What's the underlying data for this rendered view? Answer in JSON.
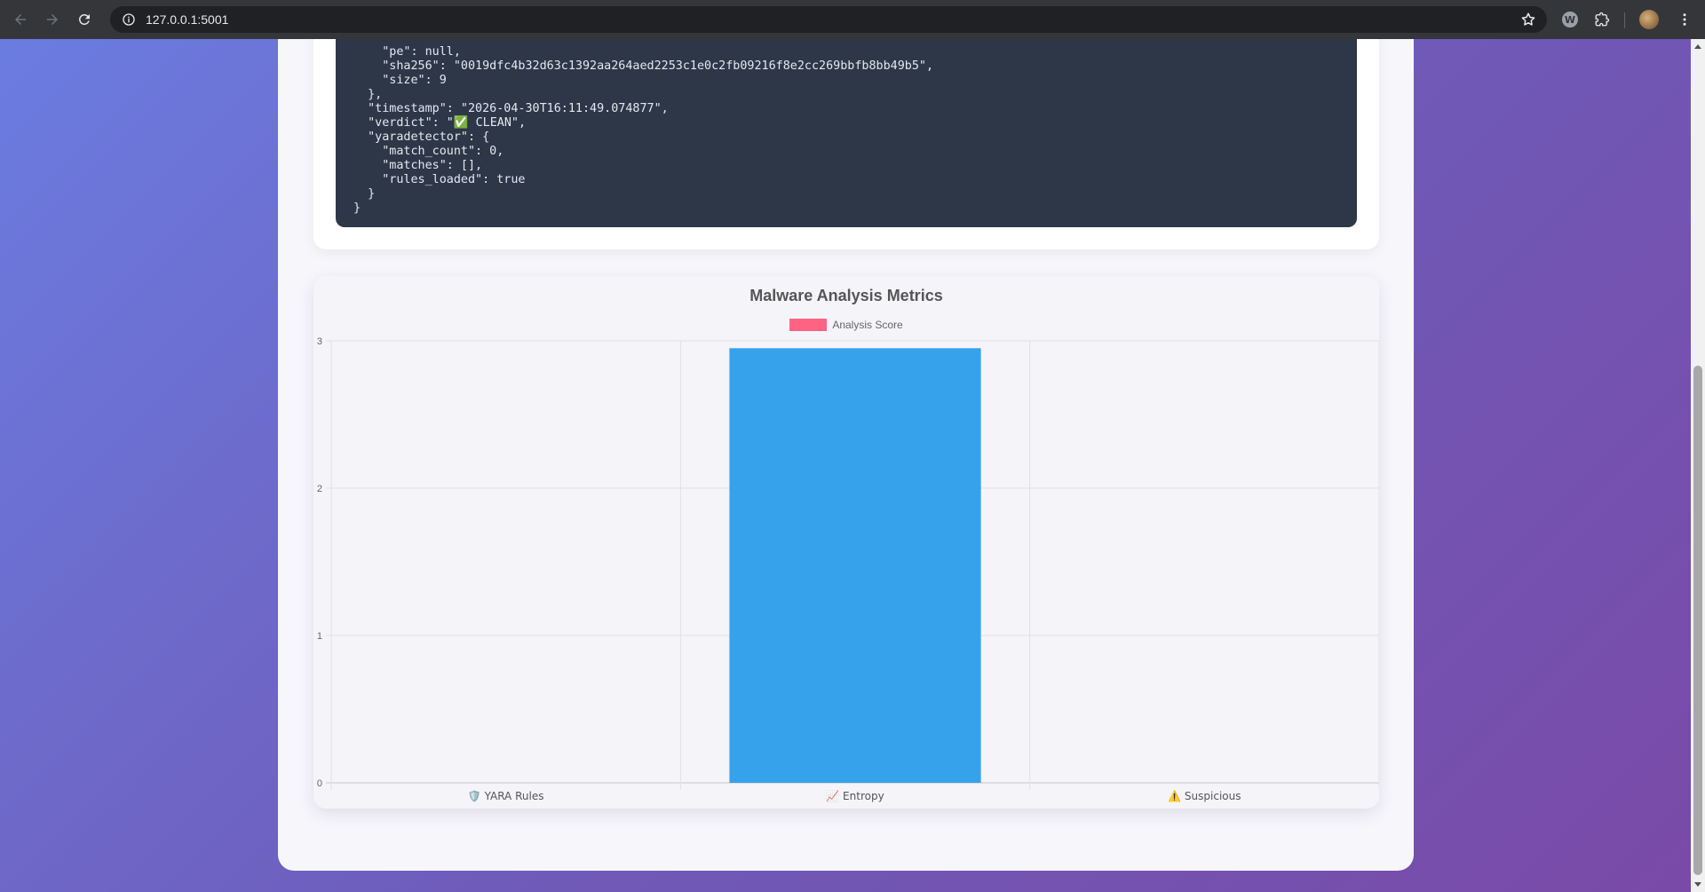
{
  "browser": {
    "url": "127.0.0.1:5001",
    "extension_letter": "W"
  },
  "json_output": {
    "lines": [
      "    \"pe\": null,",
      "    \"sha256\": \"0019dfc4b32d63c1392aa264aed2253c1e0c2fb09216f8e2cc269bbfb8bb49b5\",",
      "    \"size\": 9",
      "  },",
      "  \"timestamp\": \"2026-04-30T16:11:49.074877\",",
      "  \"verdict\": \"✅ CLEAN\",",
      "  \"yaradetector\": {",
      "    \"match_count\": 0,",
      "    \"matches\": [],",
      "    \"rules_loaded\": true",
      "  }",
      "}"
    ]
  },
  "chart_data": {
    "type": "bar",
    "title": "Malware Analysis Metrics",
    "categories": [
      "🛡️ YARA Rules",
      "📈 Entropy",
      "⚠️ Suspicious"
    ],
    "series": [
      {
        "name": "Analysis Score",
        "values": [
          0,
          2.95,
          0
        ],
        "legend_color": "#ff6384",
        "bar_color": "#36a2eb"
      }
    ],
    "ylim": [
      0,
      3
    ],
    "yticks": [
      0,
      1,
      2,
      3
    ],
    "grid": true,
    "legend_position": "top"
  }
}
